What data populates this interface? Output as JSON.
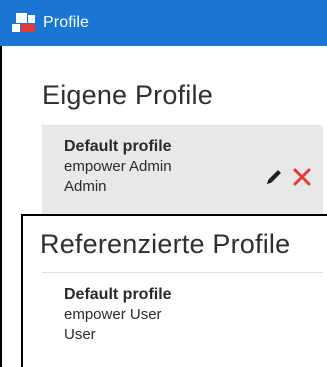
{
  "window": {
    "title": "Profile",
    "icon": "profile-app-icon"
  },
  "own_profiles": {
    "heading": "Eigene Profile",
    "items": [
      {
        "name": "Default profile",
        "line1": "empower Admin",
        "line2": "Admin",
        "selected": true,
        "actions": [
          {
            "icon": "pencil-icon",
            "label": "Edit"
          },
          {
            "icon": "close-icon",
            "label": "Delete"
          }
        ]
      }
    ]
  },
  "referenced_profiles": {
    "heading": "Referenzierte Profile",
    "items": [
      {
        "name": "Default profile",
        "line1": "empower User",
        "line2": "User"
      }
    ]
  },
  "colors": {
    "titlebar": "#1976d2",
    "selected_row": "#e8e8e8",
    "delete": "#e53935",
    "edit": "#1f1f1f"
  }
}
